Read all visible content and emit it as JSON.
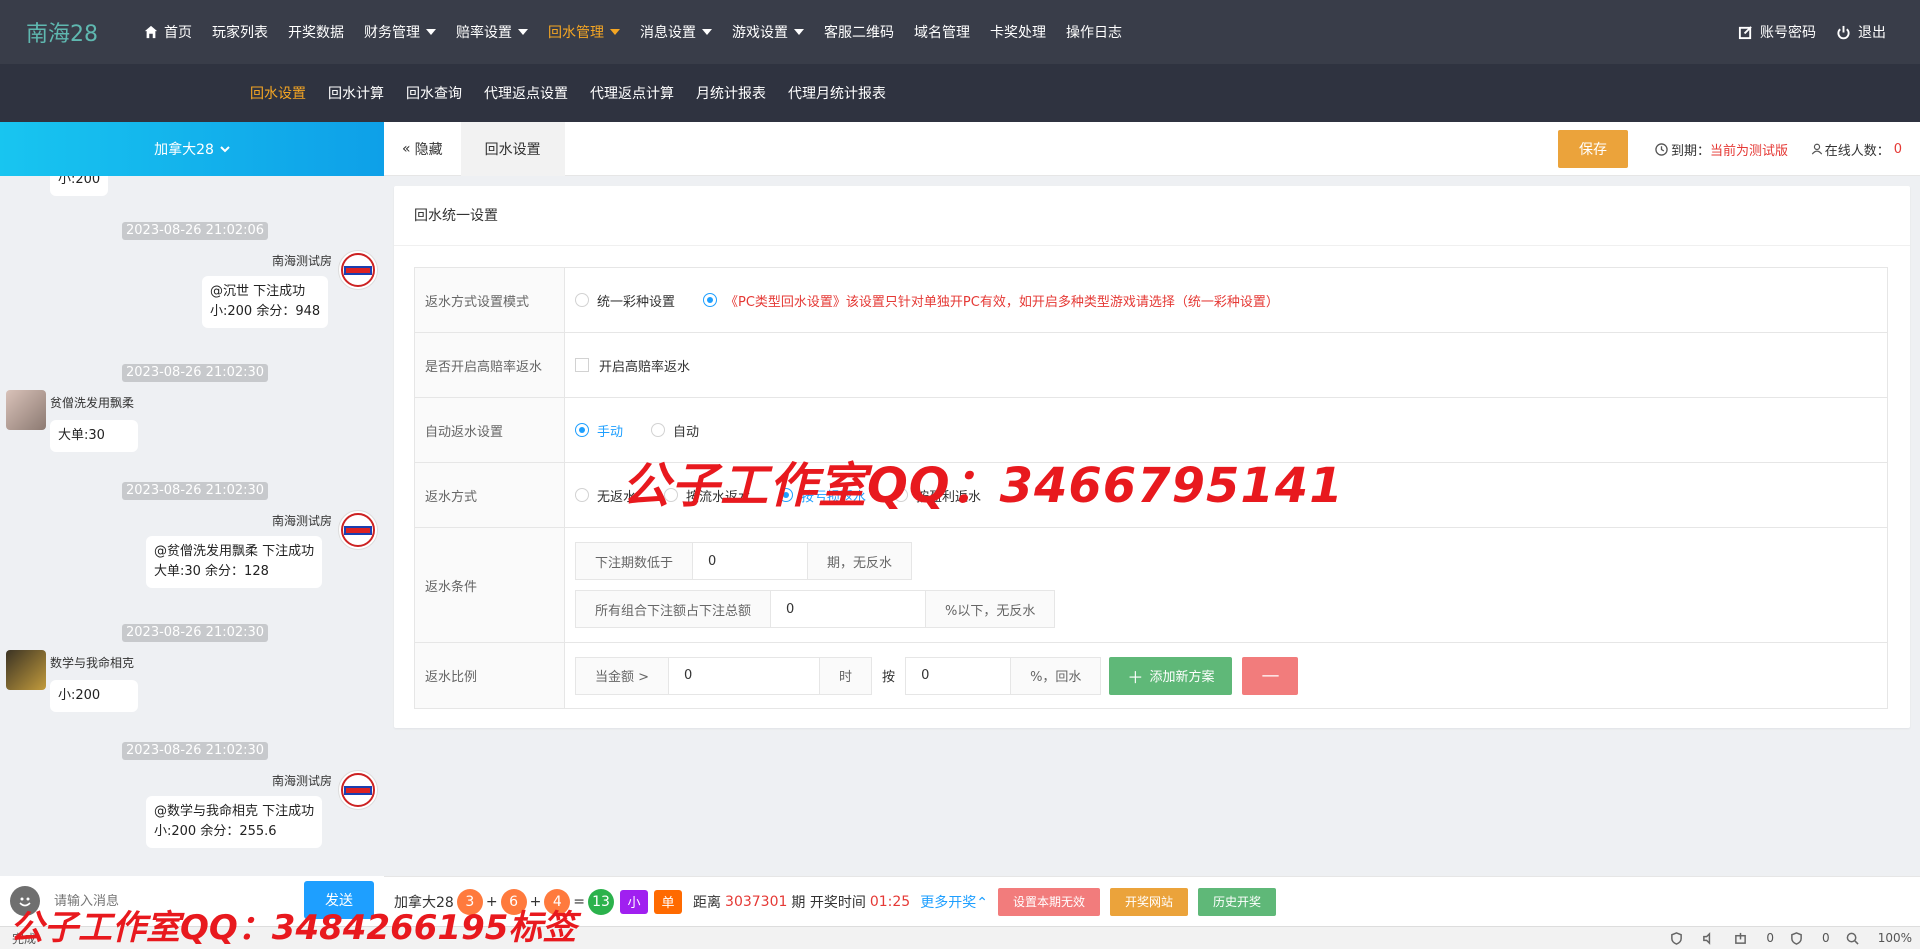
{
  "brand": "南海28",
  "nav": {
    "items": [
      {
        "label": "首页"
      },
      {
        "label": "玩家列表"
      },
      {
        "label": "开奖数据"
      },
      {
        "label": "财务管理"
      },
      {
        "label": "赔率设置"
      },
      {
        "label": "回水管理"
      },
      {
        "label": "消息设置"
      },
      {
        "label": "游戏设置"
      },
      {
        "label": "客服二维码"
      },
      {
        "label": "域名管理"
      },
      {
        "label": "卡奖处理"
      },
      {
        "label": "操作日志"
      }
    ],
    "account": "账号密码",
    "logout": "退出"
  },
  "subnav": [
    "回水设置",
    "回水计算",
    "回水查询",
    "代理返点设置",
    "代理返点计算",
    "月统计报表",
    "代理月统计报表"
  ],
  "chat": {
    "room": "加拿大28",
    "messages": {
      "top_tail": "小:200",
      "t1": "2023-08-26 21:02:06",
      "s1": "南海测试房",
      "m1a": "@沉世 下注成功",
      "m1b": "小:200 余分：948",
      "t2": "2023-08-26 21:02:30",
      "s2": "贫僧洗发用飘柔",
      "m2a": "大单:30",
      "t3": "2023-08-26 21:02:30",
      "s3": "南海测试房",
      "m3a": "@贫僧洗发用飘柔 下注成功",
      "m3b": "大单:30 余分：128",
      "t4": "2023-08-26 21:02:30",
      "s4": "数学与我命相克",
      "m4a": "小:200",
      "t5": "2023-08-26 21:02:30",
      "s5": "南海测试房",
      "m5a": "@数学与我命相克 下注成功",
      "m5b": "小:200 余分：255.6"
    },
    "input_placeholder": "请输入消息",
    "send": "发送"
  },
  "tabs": {
    "hide": "隐藏",
    "current": "回水设置",
    "save": "保存",
    "expire_label": "到期：",
    "expire_value": "当前为测试版",
    "online_label": "在线人数：",
    "online_value": "0"
  },
  "card": {
    "title": "回水统一设置",
    "rows": {
      "mode_label": "返水方式设置模式",
      "mode_opt1": "统一彩种设置",
      "mode_opt2": "《PC类型回水设置》该设置只针对单独开PC有效，如开启多种类型游戏请选择（统一彩种设置）",
      "high_label": "是否开启高赔率返水",
      "high_opt": "开启高赔率返水",
      "auto_label": "自动返水设置",
      "auto_opt1": "手动",
      "auto_opt2": "自动",
      "way_label": "返水方式",
      "way_opt1": "无返水",
      "way_opt2": "按流水返水",
      "way_opt3": "按亏损返水",
      "way_opt4": "按盈利返水",
      "cond_label": "返水条件",
      "cond1_pre": "下注期数低于",
      "cond1_val": "0",
      "cond1_post": "期，无反水",
      "cond2_pre": "所有组合下注额占下注总额",
      "cond2_val": "0",
      "cond2_post": "%以下，无反水",
      "ratio_label": "返水比例",
      "ratio_pre": "当金额 >",
      "ratio_val1": "0",
      "ratio_mid1": "时",
      "ratio_mid2": "按",
      "ratio_val2": "0",
      "ratio_post": "%，回水",
      "add_btn": "添加新方案",
      "del_btn": "—"
    }
  },
  "bottom": {
    "game": "加拿大28",
    "n1": "3",
    "plus1": "+",
    "n2": "6",
    "plus2": "+",
    "n3": "4",
    "eq": "=",
    "sum": "13",
    "tag1": "小",
    "tag2": "单",
    "dist": "距离",
    "period": "3037301",
    "period_unit": "期 开奖时间",
    "time": "01:25",
    "more": "更多开奖",
    "btn1": "设置本期无效",
    "btn2": "开奖网站",
    "btn3": "历史开奖"
  },
  "statusbar": {
    "left": "完成",
    "r1": "0",
    "r2": "0",
    "zoom": "100%"
  },
  "watermark": {
    "main": "公子工作室QQ：3466795141",
    "bottom": "公子工作室QQ：3484266195标签"
  },
  "colors": {
    "accent": "#f5a623",
    "blue": "#1e9fff",
    "green": "#5fb878",
    "red": "#e53935"
  }
}
